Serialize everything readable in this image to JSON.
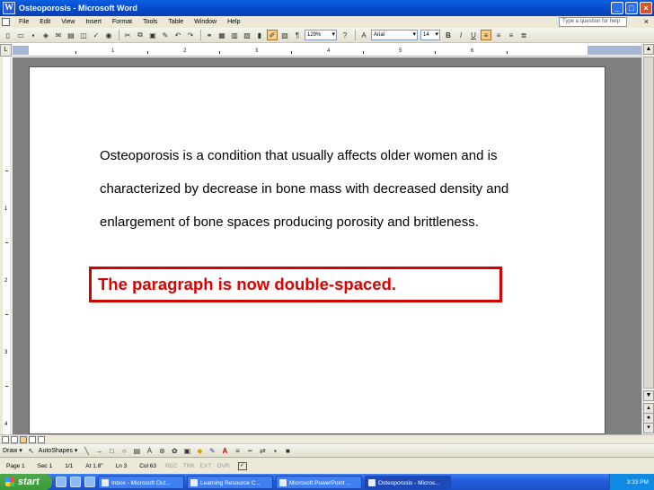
{
  "window": {
    "title": "Osteoporosis - Microsoft Word",
    "app_letter": "W"
  },
  "menu": {
    "items": [
      "File",
      "Edit",
      "View",
      "Insert",
      "Format",
      "Tools",
      "Table",
      "Window",
      "Help"
    ],
    "help_placeholder": "Type a question for help",
    "close_glyph": "×"
  },
  "toolbar": {
    "zoom": "129%",
    "font": "Arial",
    "size": "14",
    "pilcrow": "¶"
  },
  "ruler": {
    "numbers": [
      "1",
      "2",
      "3",
      "4",
      "5",
      "6"
    ]
  },
  "vruler": {
    "numbers": [
      "1",
      "2",
      "3",
      "4"
    ]
  },
  "document": {
    "lines": [
      "Osteoporosis is a condition that usually affects older women and is",
      "characterized by decrease in bone mass with decreased density and",
      "enlargement of bone spaces producing porosity and brittleness."
    ],
    "callout": "The paragraph is now double-spaced."
  },
  "drawbar": {
    "draw_label": "Draw ▾",
    "autoshapes_label": "AutoShapes ▾"
  },
  "status": {
    "page": "Page 1",
    "sec": "Sec 1",
    "pos": "1/1",
    "at": "At 1.8\"",
    "ln": "Ln 3",
    "col": "Col 63",
    "rec": "REC",
    "trk": "TRK",
    "ext": "EXT",
    "ovr": "OVR"
  },
  "taskbar": {
    "start_label": "start",
    "tasks": [
      "Inbox - Microsoft Out...",
      "Learning Resource C...",
      "Microsoft PowerPoint ...",
      "Osteoporosis - Micros..."
    ],
    "clock": "3:33 PM"
  }
}
